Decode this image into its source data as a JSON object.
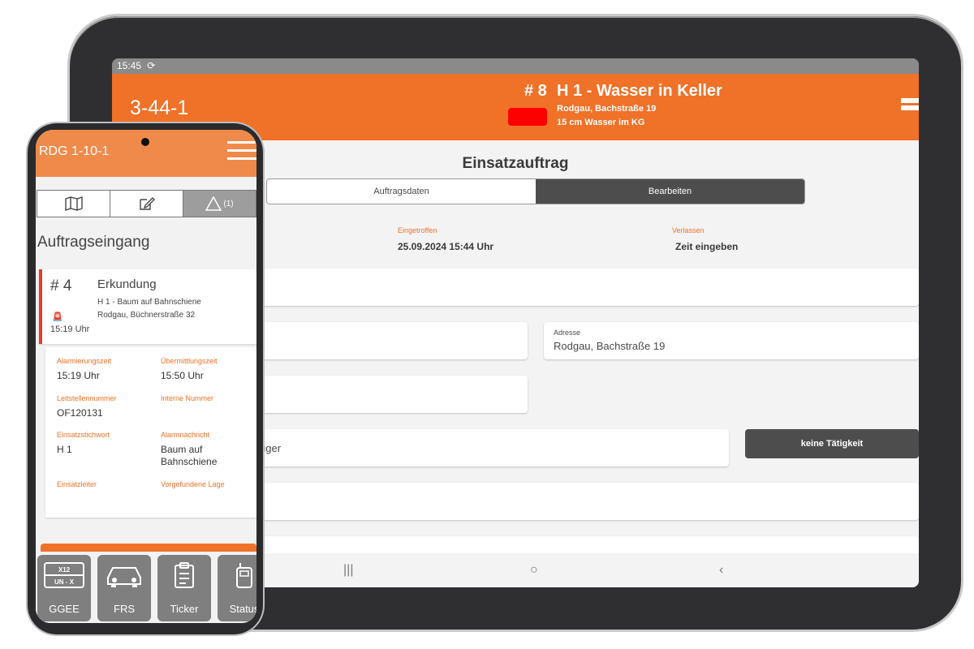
{
  "tablet": {
    "status_time": "15:45",
    "status_icon": "sync-icon",
    "unit": "3-44-1",
    "mission_number": "# 8",
    "mission_title": "H 1 - Wasser in Keller",
    "address_line": "Rodgau, Bachstraße 19",
    "detail_line": "15 cm Wasser im KG",
    "status_color": "#ff0000",
    "page_title": "Einsatzauftrag",
    "tabs": [
      {
        "label": "Auftragsdaten",
        "active": false
      },
      {
        "label": "Bearbeiten",
        "active": true
      }
    ],
    "times": [
      {
        "label": "Eingetroffen",
        "value": "25.09.2024 15:44 Uhr"
      },
      {
        "label": "Verlassen",
        "value": "Zeit eingeben"
      }
    ],
    "address_field": {
      "label": "Adresse",
      "value": "Rodgau, Bachstraße 19"
    },
    "vehicle_field_partial": "uger",
    "activity_button": "keine Tätigkeit",
    "nav": {
      "recent": "|||",
      "home": "○",
      "back": "‹"
    }
  },
  "phone": {
    "unit": "RDG 1-10-1",
    "tabs": [
      {
        "icon": "map-icon",
        "label": "",
        "active": false
      },
      {
        "icon": "edit-icon",
        "label": "",
        "active": false
      },
      {
        "icon": "warning-icon",
        "label": "(1)",
        "active": true
      }
    ],
    "section_title": "Auftragseingang",
    "card": {
      "number": "# 4",
      "title": "Erkundung",
      "line1": "H 1 - Baum auf Bahnschiene",
      "line2": "Rodgau, Büchnerstraße 32",
      "time": "15:19 Uhr"
    },
    "details": [
      {
        "label": "Alarmierungszeit",
        "value": "15:19 Uhr"
      },
      {
        "label": "Übermittlungszeit",
        "value": "15:50 Uhr"
      },
      {
        "label": "Leitstellennummer",
        "value": "OF120131"
      },
      {
        "label": "Interne Nummer",
        "value": ""
      },
      {
        "label": "Einsatzstichwort",
        "value": "H 1"
      },
      {
        "label": "Alarmnachricht",
        "value": "Baum auf Bahnschiene"
      },
      {
        "label": "Einsatzleiter",
        "value": ""
      },
      {
        "label": "Vorgefundene Lage",
        "value": ""
      }
    ],
    "bottom_buttons": [
      {
        "label": "GGEE",
        "icon": "hazard-plate-icon",
        "plate_top": "X12",
        "plate_bottom": "UN - X"
      },
      {
        "label": "FRS",
        "icon": "car-icon"
      },
      {
        "label": "Ticker",
        "icon": "clipboard-icon"
      },
      {
        "label": "Status",
        "icon": "radio-icon"
      }
    ],
    "accent_color": "#f07128"
  }
}
